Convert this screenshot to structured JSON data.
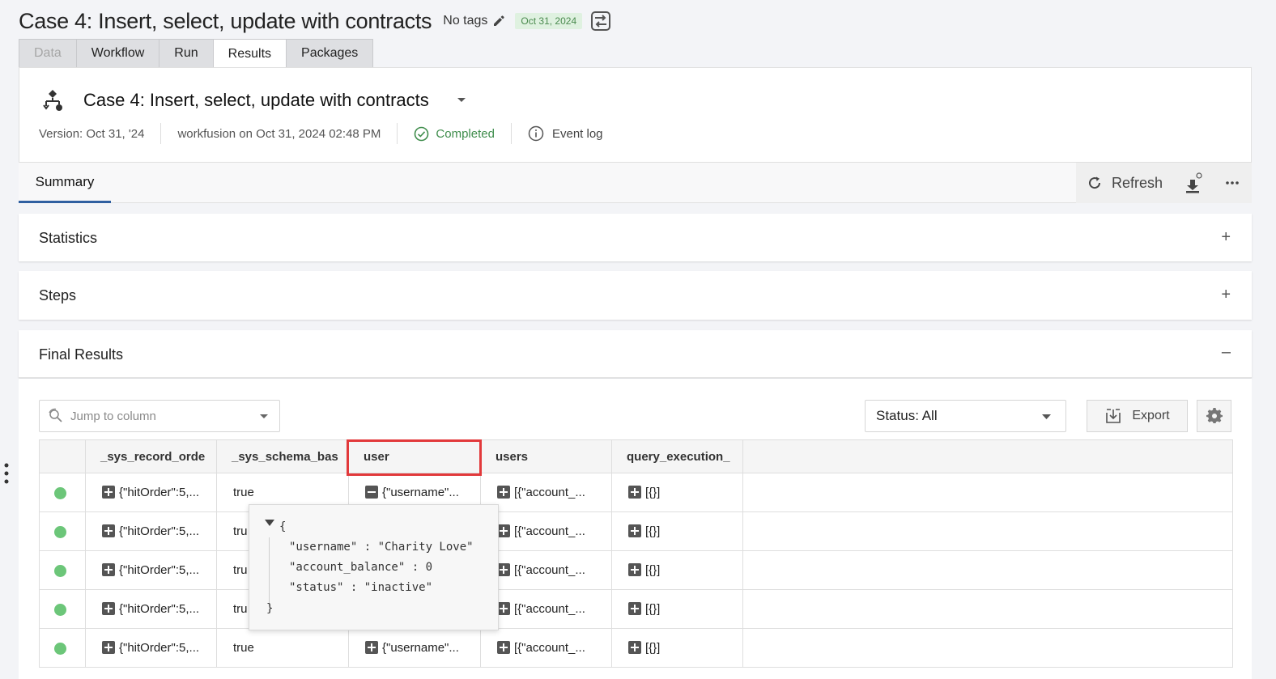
{
  "header": {
    "title": "Case 4: Insert, select, update with contracts",
    "tags_label": "No tags",
    "date_badge": "Oct 31, 2024"
  },
  "tabs": [
    {
      "label": "Data",
      "state": "disabled"
    },
    {
      "label": "Workflow",
      "state": "normal"
    },
    {
      "label": "Run",
      "state": "normal"
    },
    {
      "label": "Results",
      "state": "active"
    },
    {
      "label": "Packages",
      "state": "normal"
    }
  ],
  "workflow": {
    "title": "Case 4: Insert, select, update with contracts",
    "version": "Version: Oct 31, '24",
    "run_info": "workfusion on Oct 31, 2024 02:48 PM",
    "status": "Completed",
    "event_log": "Event log"
  },
  "summary": {
    "tab_label": "Summary",
    "refresh_label": "Refresh"
  },
  "sections": {
    "statistics": {
      "title": "Statistics",
      "toggle": "+"
    },
    "steps": {
      "title": "Steps",
      "toggle": "+"
    },
    "final_results": {
      "title": "Final Results",
      "toggle": "–"
    }
  },
  "results": {
    "jump_placeholder": "Jump to column",
    "status_filter": "Status: All",
    "export_label": "Export",
    "columns": [
      "",
      "_sys_record_orde",
      "_sys_schema_bas",
      "user",
      "users",
      "query_execution_",
      ""
    ],
    "rows": [
      {
        "record": "{\"hitOrder\":5,...",
        "schema": "true",
        "user": "{\"username\"...",
        "user_expanded": true,
        "users": "[{\"account_...",
        "query": "[{}]"
      },
      {
        "record": "{\"hitOrder\":5,...",
        "schema": "tru",
        "user": "",
        "user_expanded": false,
        "users": "[{\"account_...",
        "query": "[{}]"
      },
      {
        "record": "{\"hitOrder\":5,...",
        "schema": "tru",
        "user": "",
        "user_expanded": false,
        "users": "[{\"account_...",
        "query": "[{}]"
      },
      {
        "record": "{\"hitOrder\":5,...",
        "schema": "tru",
        "user": "",
        "user_expanded": false,
        "users": "[{\"account_...",
        "query": "[{}]"
      },
      {
        "record": "{\"hitOrder\":5,...",
        "schema": "true",
        "user": "{\"username\"...",
        "user_expanded": false,
        "users": "[{\"account_...",
        "query": "[{}]"
      }
    ]
  },
  "popover": {
    "open_brace": "{",
    "close_brace": "}",
    "line1": "\"username\" : \"Charity Love\"",
    "line2": "\"account_balance\" : 0",
    "line3": "\"status\" : \"inactive\""
  },
  "colors": {
    "accent": "#2f5fa0",
    "success": "#3f8d4c",
    "status_dot": "#6cc679",
    "highlight": "#e2393b"
  }
}
